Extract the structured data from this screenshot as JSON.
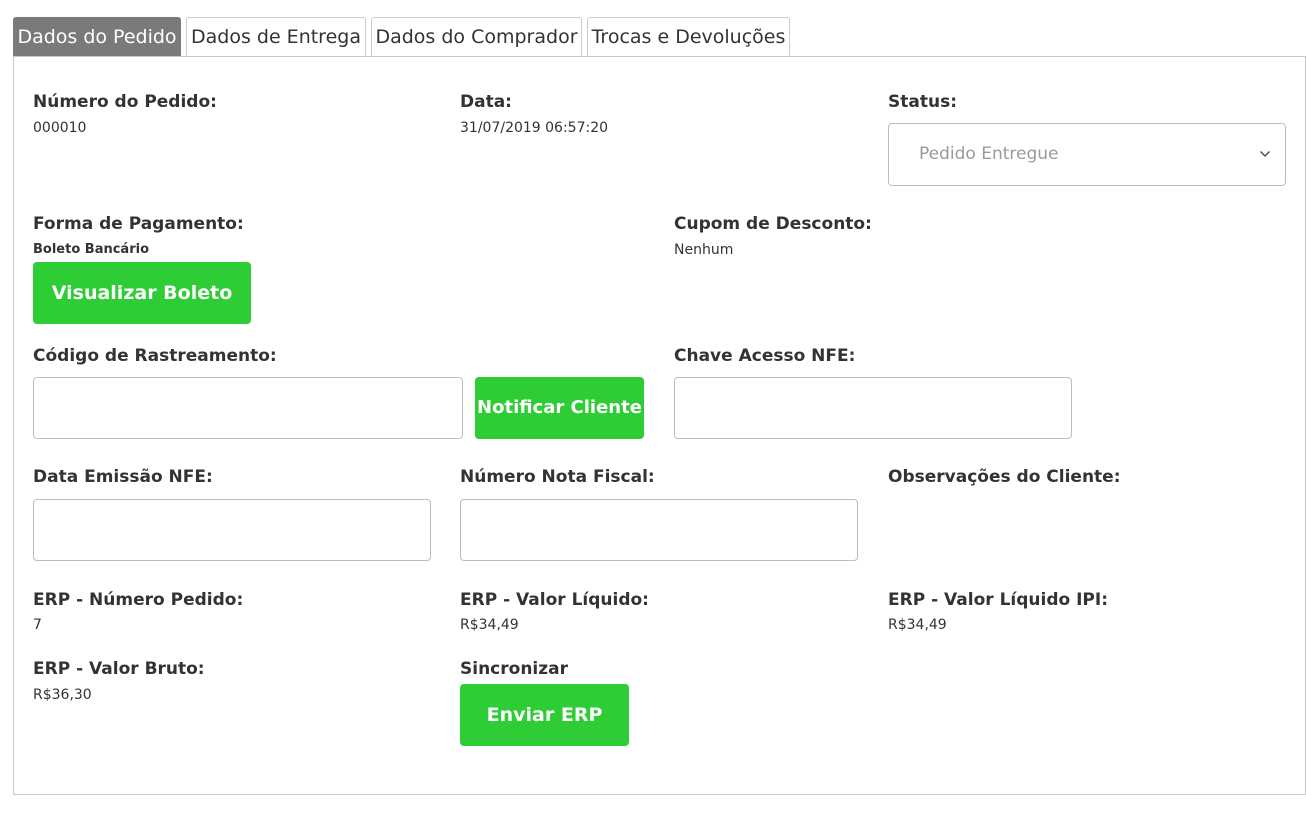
{
  "tabs": [
    {
      "label": "Dados do Pedido",
      "active": true
    },
    {
      "label": "Dados de Entrega",
      "active": false
    },
    {
      "label": "Dados do Comprador",
      "active": false
    },
    {
      "label": "Trocas e Devoluções",
      "active": false
    }
  ],
  "order": {
    "number_label": "Número do Pedido:",
    "number_value": "000010",
    "date_label": "Data:",
    "date_value": "31/07/2019 06:57:20",
    "status_label": "Status:",
    "status_value": "Pedido Entregue"
  },
  "payment": {
    "label": "Forma de Pagamento:",
    "value": "Boleto Bancário",
    "button_label": "Visualizar Boleto"
  },
  "coupon": {
    "label": "Cupom de Desconto:",
    "value": "Nenhum"
  },
  "tracking": {
    "label": "Código de Rastreamento:",
    "value": "",
    "notify_button_label": "Notificar Cliente"
  },
  "nfe": {
    "access_key_label": "Chave Acesso NFE:",
    "access_key_value": "",
    "emission_date_label": "Data Emissão NFE:",
    "emission_date_value": "",
    "invoice_number_label": "Número Nota Fiscal:",
    "invoice_number_value": ""
  },
  "notes": {
    "label": "Observações do Cliente:"
  },
  "erp": {
    "order_number_label": "ERP - Número Pedido:",
    "order_number_value": "7",
    "net_value_label": "ERP - Valor Líquido:",
    "net_value_value": "R$34,49",
    "net_value_ipi_label": "ERP - Valor Líquido IPI:",
    "net_value_ipi_value": "R$34,49",
    "gross_value_label": "ERP - Valor Bruto:",
    "gross_value_value": "R$36,30",
    "sync_label": "Sincronizar",
    "send_button_label": "Enviar ERP"
  },
  "colors": {
    "accent_green": "#2ecc35",
    "active_tab": "#7a7a7a"
  }
}
